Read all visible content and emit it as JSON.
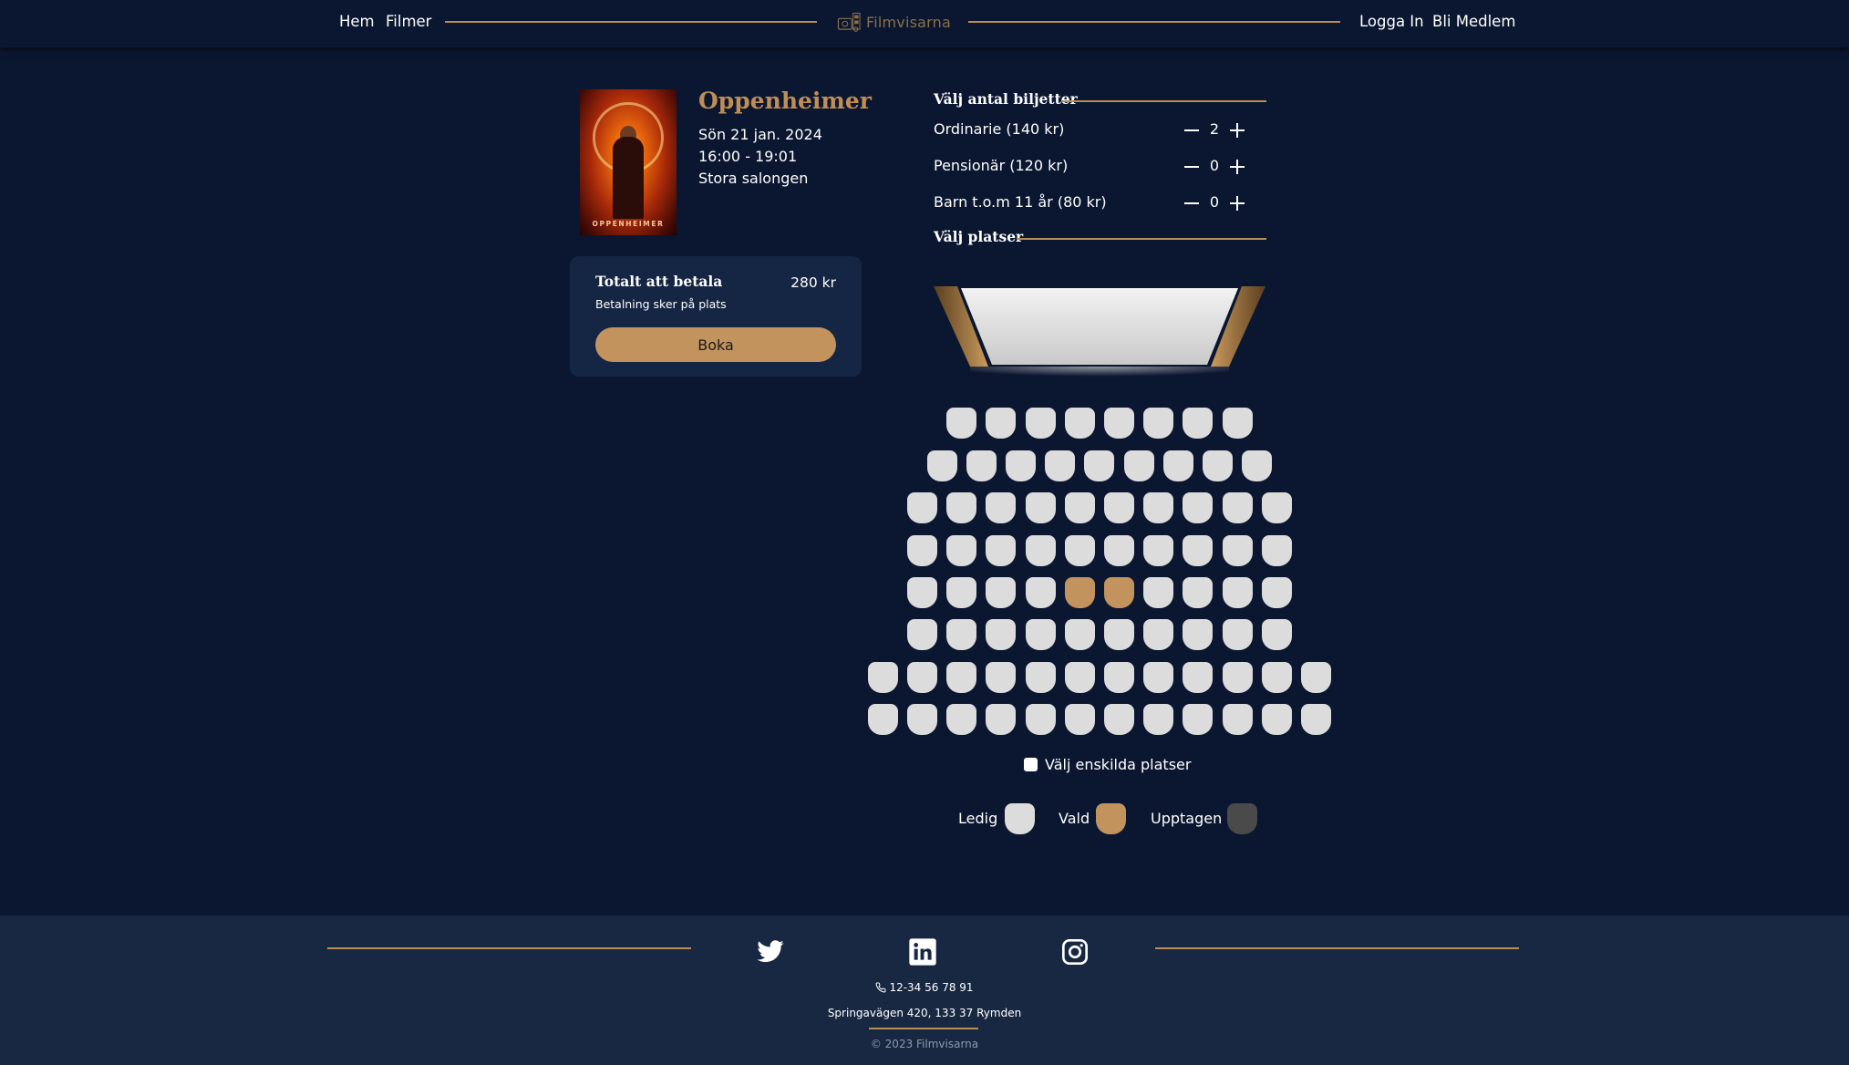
{
  "nav": {
    "home": "Hem",
    "movies": "Filmer",
    "logo_text": "Filmvisarna",
    "login": "Logga In",
    "become_member": "Bli Medlem"
  },
  "movie": {
    "title": "Oppenheimer",
    "poster_text": "OPPENHEIMER",
    "date": "Sön 21 jan. 2024",
    "time": "16:00 - 19:01",
    "salon": "Stora salongen"
  },
  "total": {
    "label": "Totalt att betala",
    "value": "280 kr",
    "note": "Betalning sker på plats",
    "book_button": "Boka"
  },
  "tickets": {
    "heading": "Välj antal biljetter",
    "types": [
      {
        "label": "Ordinarie (140 kr)",
        "count": "2"
      },
      {
        "label": "Pensionär (120 kr)",
        "count": "0"
      },
      {
        "label": "Barn t.o.m 11 år (80 kr)",
        "count": "0"
      }
    ]
  },
  "seats": {
    "heading": "Välj platser",
    "rows": [
      {
        "count": 8,
        "selected": []
      },
      {
        "count": 9,
        "selected": []
      },
      {
        "count": 10,
        "selected": []
      },
      {
        "count": 10,
        "selected": []
      },
      {
        "count": 10,
        "selected": [
          5,
          6
        ]
      },
      {
        "count": 10,
        "selected": []
      },
      {
        "count": 12,
        "selected": []
      },
      {
        "count": 12,
        "selected": []
      }
    ],
    "single_seats_label": "Välj enskilda platser",
    "single_seats_checked": false
  },
  "legend": {
    "free": "Ledig",
    "selected": "Vald",
    "taken": "Upptagen"
  },
  "colors": {
    "background": "#0b1730",
    "accent": "#c2935d",
    "seat_free": "#dcdcdc",
    "seat_selected": "#c2935d",
    "seat_taken": "#4a4a4a",
    "footer": "#182842"
  },
  "footer": {
    "social": [
      "twitter-icon",
      "linkedin-icon",
      "instagram-icon"
    ],
    "phone": "12-34 56 78 91",
    "address": "Springavägen 420, 133 37 Rymden",
    "copyright": "© 2023 Filmvisarna"
  }
}
